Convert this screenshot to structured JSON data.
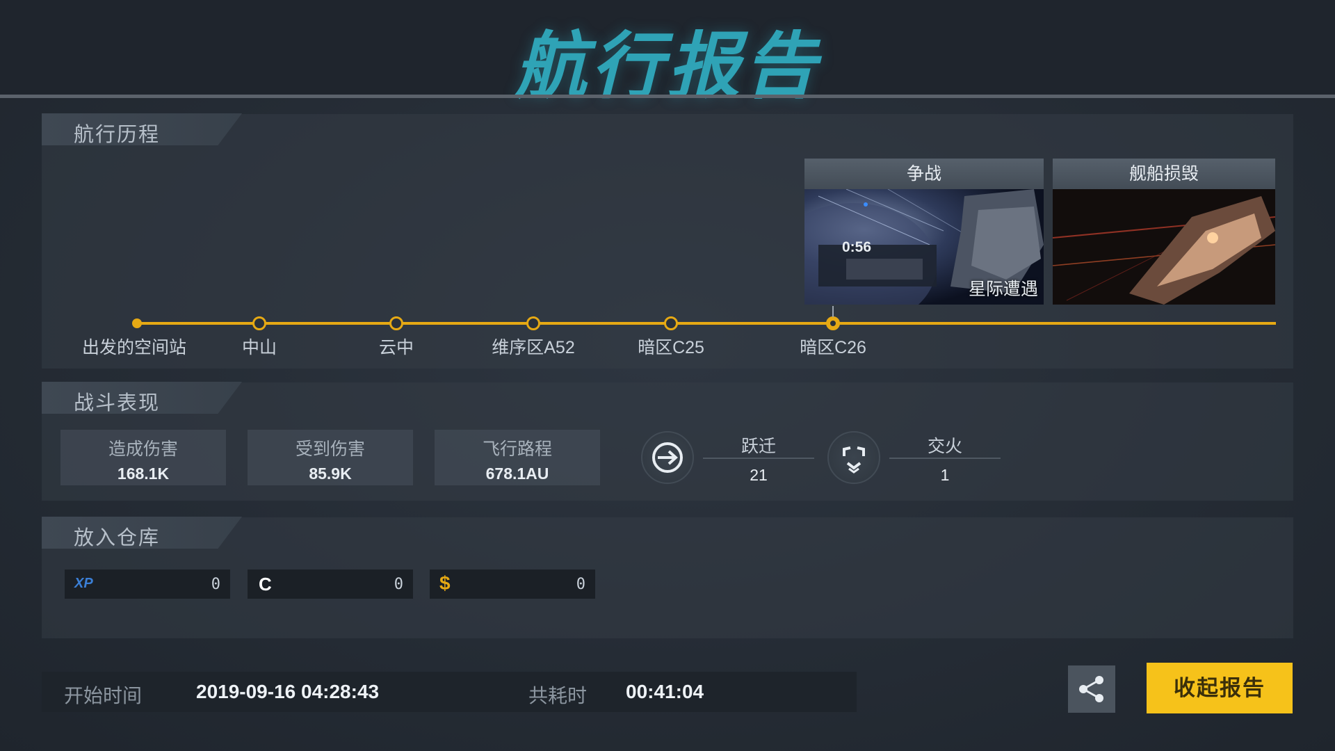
{
  "header": {
    "title": "航行报告"
  },
  "voyage": {
    "section_label": "航行历程",
    "stops": [
      "出发的空间站",
      "中山",
      "云中",
      "维序区A52",
      "暗区C25",
      "暗区C26"
    ],
    "events": [
      {
        "title": "争战",
        "time": "0:56",
        "caption": "星际遭遇"
      },
      {
        "title": "舰船损毁"
      }
    ]
  },
  "combat": {
    "section_label": "战斗表现",
    "stats": [
      {
        "label": "造成伤害",
        "value": "168.1K"
      },
      {
        "label": "受到伤害",
        "value": "85.9K"
      },
      {
        "label": "飞行路程",
        "value": "678.1AU"
      }
    ],
    "jump": {
      "label": "跃迁",
      "value": "21",
      "icon": "warp-arrow-icon"
    },
    "engage": {
      "label": "交火",
      "value": "1",
      "icon": "crosshair-icon"
    }
  },
  "warehouse": {
    "section_label": "放入仓库",
    "items": [
      {
        "symbol": "XP",
        "value": "0",
        "color": "#3b7fd6"
      },
      {
        "symbol": "C",
        "value": "0",
        "color": "#ffffff"
      },
      {
        "symbol": "$",
        "value": "0",
        "color": "#e6a914"
      }
    ]
  },
  "footer": {
    "start_label": "开始时间",
    "start_value": "2019-09-16 04:28:43",
    "duration_label": "共耗时",
    "duration_value": "00:41:04",
    "collapse_label": "收起报告",
    "share_icon": "share-icon"
  },
  "colors": {
    "accent": "#e6a914",
    "title": "#2fa3b6",
    "button": "#f6c21a"
  }
}
